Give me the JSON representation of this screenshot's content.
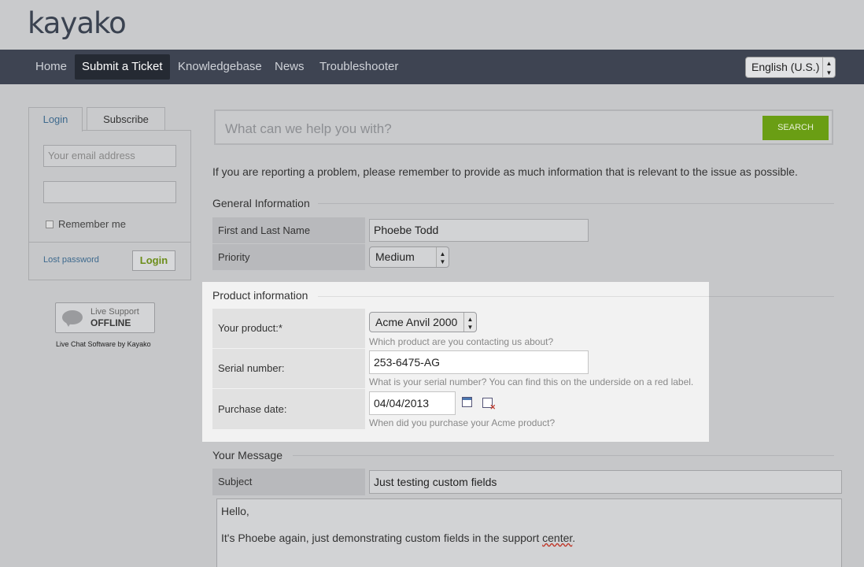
{
  "header": {
    "logo": "kayako"
  },
  "nav": {
    "items": [
      "Home",
      "Submit a Ticket",
      "Knowledgebase",
      "News",
      "Troubleshooter"
    ],
    "active": "Submit a Ticket",
    "language": "English (U.S.)"
  },
  "sidebar": {
    "tabs": [
      "Login",
      "Subscribe"
    ],
    "email_placeholder": "Your email address",
    "remember_label": "Remember me",
    "lost_password": "Lost password",
    "login_button": "Login",
    "live_support": {
      "line1": "Live Support",
      "status": "OFFLINE"
    },
    "credit_prefix": "Live Chat Software",
    "credit_by": "by",
    "credit_brand": "Kayako"
  },
  "search": {
    "placeholder": "What can we help you with?",
    "button": "SEARCH"
  },
  "intro": "If you are reporting a problem, please remember to provide as much information that is relevant to the issue as possible.",
  "general": {
    "title": "General Information",
    "name_label": "First and Last Name",
    "name_value": "Phoebe Todd",
    "priority_label": "Priority",
    "priority_value": "Medium"
  },
  "product": {
    "title": "Product information",
    "product_label": "Your product:*",
    "product_value": "Acme Anvil 2000",
    "product_hint": "Which product are you contacting us about?",
    "serial_label": "Serial number:",
    "serial_value": "253-6475-AG",
    "serial_hint": "What is your serial number? You can find this on the underside on a red label.",
    "date_label": "Purchase date:",
    "date_value": "04/04/2013",
    "date_hint": "When did you purchase your Acme product?"
  },
  "message": {
    "title": "Your Message",
    "subject_label": "Subject",
    "subject_value": "Just testing custom fields",
    "body_line1": "Hello,",
    "body_line2_a": "It's Phoebe again, just demonstrating custom fields in the support ",
    "body_line2_b": "center",
    "body_line2_c": "."
  },
  "colors": {
    "accent_green": "#6a9e14",
    "nav_bg": "#3e4452",
    "link_blue": "#3e6a8e"
  }
}
